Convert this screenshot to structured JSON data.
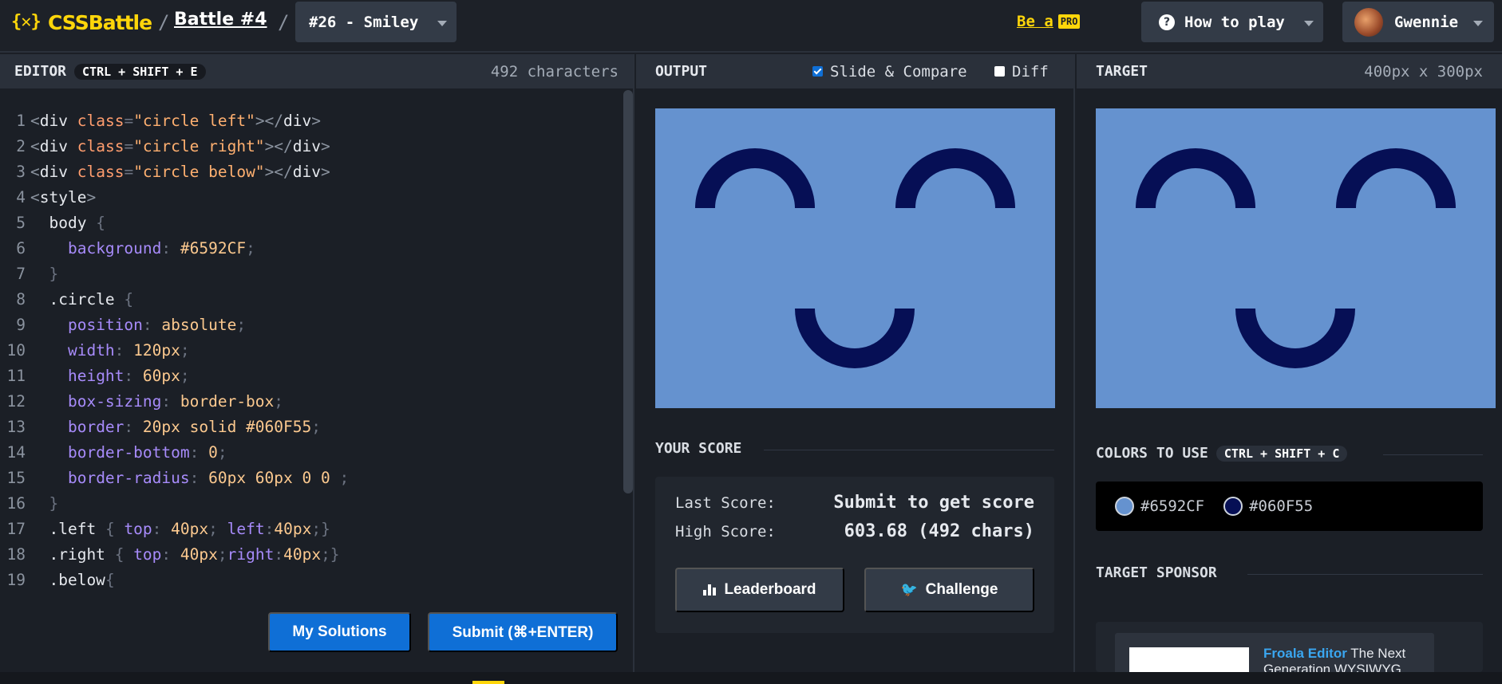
{
  "header": {
    "logo_mark": "{✕}",
    "logo_text": "CSSBattle",
    "separator": "/",
    "battle_link": "Battle #4",
    "target_select": "#26 - Smiley",
    "be_a": "Be a",
    "pro": "PRO",
    "how_to_play": "How to play",
    "user_name": "Gwennie"
  },
  "editor": {
    "title": "EDITOR",
    "shortcut": "CTRL + SHIFT + E",
    "char_count": "492 characters",
    "my_solutions": "My Solutions",
    "submit": "Submit (⌘+ENTER)"
  },
  "output": {
    "title": "OUTPUT",
    "slide_compare": "Slide & Compare",
    "slide_compare_checked": true,
    "diff": "Diff",
    "diff_checked": false,
    "your_score": "YOUR SCORE",
    "last_score_label": "Last Score:",
    "last_score_value": "Submit to get score",
    "high_score_label": "High Score:",
    "high_score_value": "603.68 (492 chars)",
    "leaderboard": "Leaderboard",
    "challenge": "Challenge"
  },
  "target": {
    "title": "TARGET",
    "dimensions": "400px x 300px",
    "colors_title": "COLORS TO USE",
    "colors_shortcut": "CTRL + SHIFT + C",
    "colors": [
      "#6592CF",
      "#060F55"
    ],
    "sponsor_title": "TARGET SPONSOR",
    "sponsor_brand": "Froala Editor",
    "sponsor_text": "The Next Generation WYSIWYG"
  },
  "colors": {
    "accent": "#ffd60a",
    "primary_button": "#0f6fd6",
    "canvas_bg": "#6592cf",
    "shape": "#060f55"
  }
}
